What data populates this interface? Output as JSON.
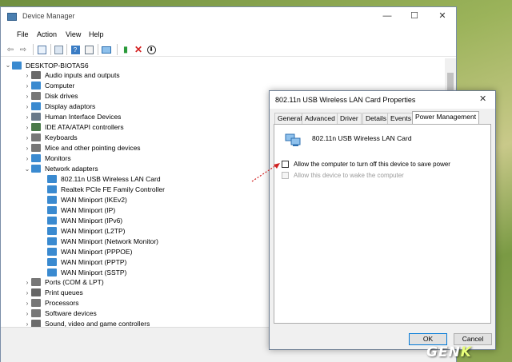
{
  "device_manager": {
    "title": "Device Manager",
    "menu": [
      "File",
      "Action",
      "View",
      "Help"
    ],
    "toolbar_icons": [
      "back-arrow-icon",
      "forward-arrow-icon",
      "properties-icon",
      "refresh-icon",
      "help-icon",
      "view-icon",
      "monitor-icon",
      "enable-device-icon",
      "uninstall-x-icon",
      "update-driver-icon"
    ],
    "tree": {
      "root": "DESKTOP-BIOTAS6",
      "categories": [
        {
          "label": "Audio inputs and outputs",
          "icon": "speaker-icon",
          "color": "#6a6a6a"
        },
        {
          "label": "Computer",
          "icon": "computer-icon",
          "color": "#3a8ad0"
        },
        {
          "label": "Disk drives",
          "icon": "disk-icon",
          "color": "#777777"
        },
        {
          "label": "Display adaptors",
          "icon": "display-icon",
          "color": "#3a8ad0"
        },
        {
          "label": "Human Interface Devices",
          "icon": "hid-icon",
          "color": "#6a7a8a"
        },
        {
          "label": "IDE ATA/ATAPI controllers",
          "icon": "ide-icon",
          "color": "#4a7a4a"
        },
        {
          "label": "Keyboards",
          "icon": "keyboard-icon",
          "color": "#777777"
        },
        {
          "label": "Mice and other pointing devices",
          "icon": "mouse-icon",
          "color": "#777777"
        },
        {
          "label": "Monitors",
          "icon": "monitor-icon",
          "color": "#3a8ad0"
        },
        {
          "label": "Network adapters",
          "icon": "network-icon",
          "color": "#3a8ad0"
        }
      ],
      "network_children": [
        "802.11n USB Wireless LAN Card",
        "Realtek PCIe FE Family Controller",
        "WAN Miniport (IKEv2)",
        "WAN Miniport (IP)",
        "WAN Miniport (IPv6)",
        "WAN Miniport (L2TP)",
        "WAN Miniport (Network Monitor)",
        "WAN Miniport (PPPOE)",
        "WAN Miniport (PPTP)",
        "WAN Miniport (SSTP)"
      ],
      "after": [
        {
          "label": "Ports (COM & LPT)",
          "icon": "port-icon",
          "color": "#777777"
        },
        {
          "label": "Print queues",
          "icon": "printer-icon",
          "color": "#666666"
        },
        {
          "label": "Processors",
          "icon": "processor-icon",
          "color": "#777777"
        },
        {
          "label": "Software devices",
          "icon": "software-icon",
          "color": "#777777"
        },
        {
          "label": "Sound, video and game controllers",
          "icon": "sound-icon",
          "color": "#6a6a6a"
        }
      ]
    }
  },
  "properties_dialog": {
    "title": "802.11n USB Wireless LAN Card Properties",
    "tabs": [
      "General",
      "Advanced",
      "Driver",
      "Details",
      "Events",
      "Power Management"
    ],
    "active_tab": "Power Management",
    "device_name": "802.11n USB Wireless LAN Card",
    "options": [
      {
        "label": "Allow the computer to turn off this device to save power",
        "checked": false,
        "enabled": true
      },
      {
        "label": "Allow this device to wake the computer",
        "checked": false,
        "enabled": false
      }
    ],
    "ok_label": "OK",
    "cancel_label": "Cancel"
  },
  "watermark": {
    "main": "GEN",
    "accent": "K"
  },
  "colors": {
    "accent": "#0078d7",
    "annotation_arrow": "#d02020"
  }
}
